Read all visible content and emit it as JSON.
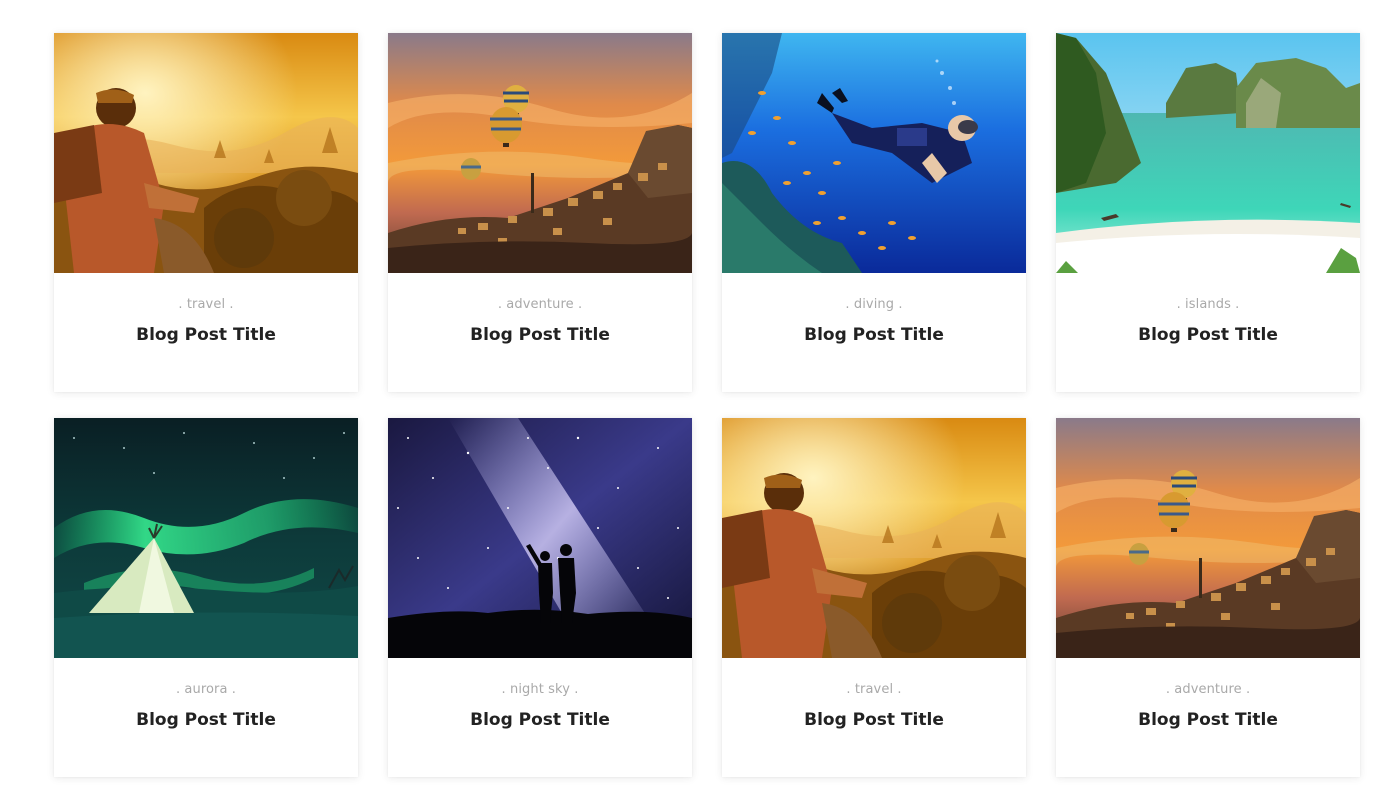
{
  "posts": [
    {
      "category": ". travel .",
      "title": "Blog Post Title",
      "image": "traveler-sunset-temples-photo"
    },
    {
      "category": ". adventure .",
      "title": "Blog Post Title",
      "image": "hot-air-balloons-town-photo"
    },
    {
      "category": ". diving .",
      "title": "Blog Post Title",
      "image": "scuba-diver-coral-photo"
    },
    {
      "category": ". islands .",
      "title": "Blog Post Title",
      "image": "tropical-lagoon-cliffs-photo"
    },
    {
      "category": ". aurora .",
      "title": "Blog Post Title",
      "image": "aurora-tent-snow-photo"
    },
    {
      "category": ". night sky .",
      "title": "Blog Post Title",
      "image": "milky-way-couple-silhouette-photo"
    },
    {
      "category": ". travel .",
      "title": "Blog Post Title",
      "image": "traveler-sunset-temples-photo"
    },
    {
      "category": ". adventure .",
      "title": "Blog Post Title",
      "image": "hot-air-balloons-town-photo"
    }
  ],
  "colors": {
    "category_text": "#a9a9a9",
    "title_text": "#222222",
    "card_background": "#ffffff"
  }
}
